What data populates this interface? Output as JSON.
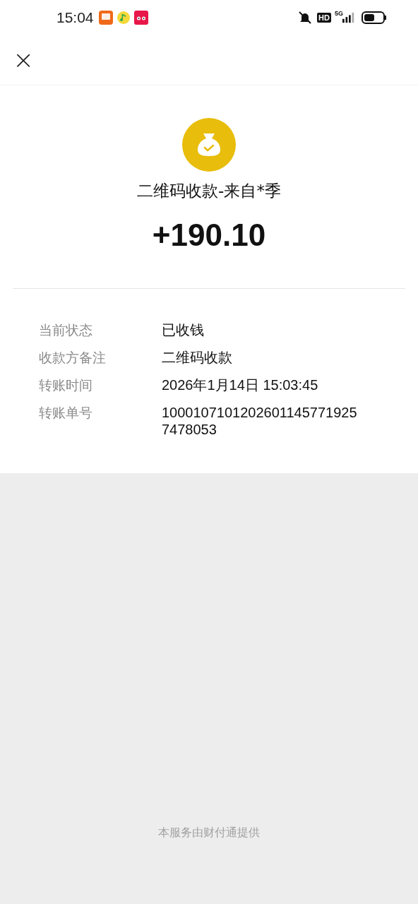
{
  "status_bar": {
    "time": "15:04",
    "network_badge": "HD",
    "network_type": "5G"
  },
  "header": {
    "close_icon": "×"
  },
  "summary": {
    "title": "二维码收款-来自*季",
    "amount": "+190.10"
  },
  "details": [
    {
      "label": "当前状态",
      "value": "已收钱"
    },
    {
      "label": "收款方备注",
      "value": "二维码收款"
    },
    {
      "label": "转账时间",
      "value": "2026年1月14日 15:03:45"
    },
    {
      "label": "转账单号",
      "value": "10001071012026011457719257478053"
    }
  ],
  "footer": "本服务由财付通提供"
}
